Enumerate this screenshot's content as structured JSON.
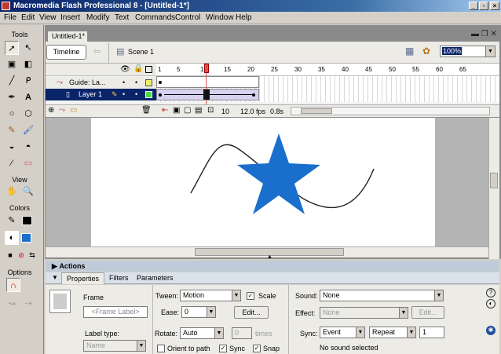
{
  "window": {
    "title": "Macromedia Flash Professional 8 - [Untitled-1*]"
  },
  "menu": [
    "File",
    "Edit",
    "View",
    "Insert",
    "Modify",
    "Text",
    "Commands",
    "Control",
    "Window",
    "Help"
  ],
  "tools": {
    "header": "Tools",
    "view_label": "View",
    "colors_label": "Colors",
    "options_label": "Options"
  },
  "document": {
    "tab": "Untitled-1*",
    "timeline_button": "Timeline",
    "scene": "Scene 1",
    "zoom": "100%"
  },
  "timeline": {
    "ruler": [
      "1",
      "5",
      "10",
      "15",
      "20",
      "25",
      "30",
      "35",
      "40",
      "45",
      "50",
      "55",
      "60",
      "65"
    ],
    "layers": [
      {
        "name": "Guide: La..."
      },
      {
        "name": "Layer 1"
      }
    ],
    "current_frame": "10",
    "fps": "12.0 fps",
    "time": "0.8s"
  },
  "panels": {
    "actions": "Actions",
    "properties": "Properties",
    "filters": "Filters",
    "parameters": "Parameters"
  },
  "properties": {
    "frame_label": "Frame",
    "frame_label_placeholder": "<Frame Label>",
    "label_type_label": "Label type:",
    "label_type_value": "Name",
    "tween_label": "Tween:",
    "tween_value": "Motion",
    "scale_label": "Scale",
    "ease_label": "Ease:",
    "ease_value": "0",
    "edit_label": "Edit...",
    "rotate_label": "Rotate:",
    "rotate_value": "Auto",
    "rotate_times_value": "0",
    "times_label": "times",
    "orient_label": "Orient to path",
    "sync_check_label": "Sync",
    "snap_label": "Snap",
    "sound_label": "Sound:",
    "sound_value": "None",
    "effect_label": "Effect:",
    "effect_value": "None",
    "effect_edit_label": "Edit...",
    "sync_label": "Sync:",
    "sync_value": "Event",
    "repeat_value": "Repeat",
    "repeat_count": "1",
    "no_sound": "No sound selected"
  },
  "colors": {
    "star": "#1a6fcc",
    "fill_swatch": "#1a6fcc",
    "playhead": "#e05050"
  }
}
